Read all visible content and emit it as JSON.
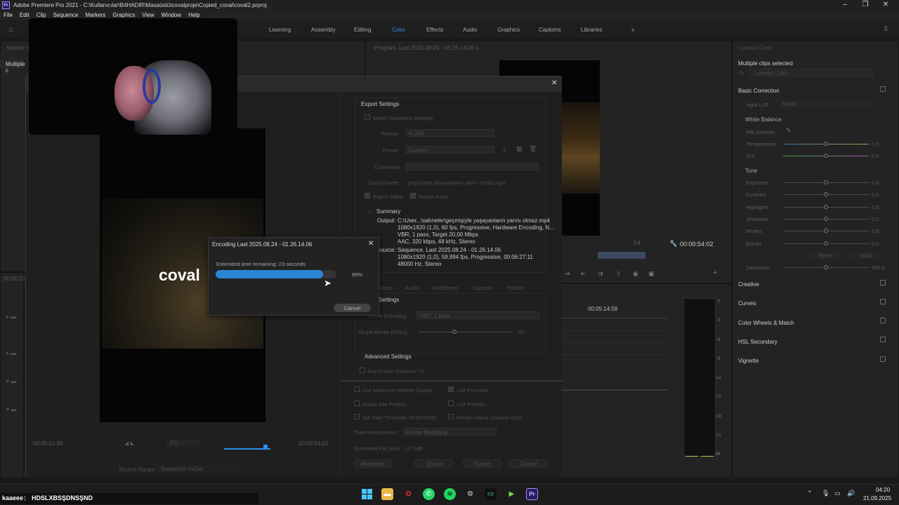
{
  "window": {
    "app_icon": "Pr",
    "title": "Adobe Premiere Pro 2021 - C:\\Kullanıcılar\\B4HADIR\\Masaüstü\\covalproje\\Copied_coval\\coval2.prproj",
    "controls": [
      "–",
      "❐",
      "✕"
    ]
  },
  "menu": [
    "File",
    "Edit",
    "Clip",
    "Sequence",
    "Markers",
    "Graphics",
    "View",
    "Window",
    "Help"
  ],
  "workspaces": {
    "tabs": [
      "Learning",
      "Assembly",
      "Editing",
      "Color",
      "Effects",
      "Audio",
      "Graphics",
      "Captions",
      "Libraries"
    ],
    "active": "Color",
    "more": "»"
  },
  "source_monitor": {
    "label": "Source: (no clips)",
    "timecode_left": "00:05:01:38"
  },
  "program_monitor": {
    "label": "Program: Last 2025.08.24 - 01.26.14.06  ≡",
    "timecode": "00:00:54:02",
    "zoom": "1/4"
  },
  "left_panel": {
    "header": "Multiple c",
    "timecode": "00:05:01:"
  },
  "timeline": {
    "timecode": "00:05:14:58"
  },
  "lumetri": {
    "title": "Lumetri Color",
    "clip_info": "Multiple clips selected",
    "fx_selector": "Lumetri Color",
    "basic_correction": "Basic Correction",
    "input_lut_label": "Input LUT",
    "input_lut_value": "None",
    "white_balance": "White Balance",
    "wb_selector": "WB Selector",
    "temperature": {
      "label": "Temperature",
      "value": "0,0"
    },
    "tint": {
      "label": "Tint",
      "value": "0,0"
    },
    "tone": "Tone",
    "exposure": {
      "label": "Exposure",
      "value": "0,0"
    },
    "contrast": {
      "label": "Contrast",
      "value": "0,0"
    },
    "highlights": {
      "label": "Highlights",
      "value": "0,0"
    },
    "shadows": {
      "label": "Shadows",
      "value": "0,0"
    },
    "whites": {
      "label": "Whites",
      "value": "0,0"
    },
    "blacks": {
      "label": "Blacks",
      "value": "0,0"
    },
    "reset": "Reset",
    "auto": "Auto",
    "saturation": {
      "label": "Saturation",
      "value": "100,0"
    },
    "sections": [
      "Creative",
      "Curves",
      "Color Wheels & Match",
      "HSL Secondary",
      "Vignette"
    ]
  },
  "export_dialog": {
    "close": "✕",
    "preview_text": "coval",
    "source_range_label": "Source Range:",
    "source_range_value": "Sequence In/Out",
    "fit": "Fit",
    "timecode_left": "00:05:01:38",
    "timecode_right": "00:00:54:02",
    "export_settings": "Export Settings",
    "match_sequence": "Match Sequence Settings",
    "format_label": "Format:",
    "format_value": "H.264",
    "preset_label": "Preset:",
    "preset_value": "Custom",
    "comments_label": "Comments:",
    "output_name_label": "Output Name:",
    "output_name_value": "geçmişiyle yaşayanların yarını olmaz.mp4",
    "export_video": "Export Video",
    "export_audio": "Export Audio",
    "summary": "Summary",
    "output_label": "Output:",
    "output_lines": [
      "C:\\User...\\sahneler\\geçmişiyle yaşayanların yarını olmaz.mp4",
      "1080x1920 (1,0), 60 fps, Progressive, Hardware Encoding, N...",
      "VBR, 1 pass, Target 20,00 Mbps",
      "AAC, 320 kbps, 48 kHz, Stereo"
    ],
    "source_label": "Source:",
    "source_lines": [
      "Sequence, Last 2025.08.24 - 01.26.14.06",
      "1080x1920 (1,0), 59,994 fps, Progressive, 00:06:27:11",
      "48000 Hz, Stereo"
    ],
    "tabs": [
      "Video",
      "Audio",
      "Multiplexer",
      "Captions",
      "Publish"
    ],
    "bitrate_settings": "Bitrate Settings",
    "bitrate_encoding_label": "Bitrate Encoding:",
    "bitrate_encoding_value": "VBR, 1 pass",
    "target_bitrate_label": "Target Bitrate [Mbps]:",
    "target_bitrate_value": "20",
    "advanced_settings": "Advanced Settings",
    "key_frame_label": "Key Frame Distance:",
    "key_frame_value": "72",
    "use_max_render": "Use Maximum Render Quality",
    "use_previews": "Use Previews",
    "import_into_project": "Import into Project",
    "use_proxies": "Use Proxies",
    "set_start_timecode": "Set Start Timecode",
    "start_timecode": "00:00:00:00",
    "render_alpha": "Render Alpha Channel Only",
    "time_interp_label": "Time Interpolation:",
    "time_interp_value": "Frame Sampling",
    "file_size_label": "Estimated File Size:",
    "file_size_value": "137 MB",
    "buttons": [
      "Metadata...",
      "Queue",
      "Export",
      "Cancel"
    ]
  },
  "encoding": {
    "title": "Encoding Last 2025.08.24 - 01.26.14.06",
    "close": "✕",
    "estimate": "Estimated time remaining: 23 seconds",
    "progress": 0.89,
    "percent": "89%",
    "cancel": "Cancel"
  },
  "meter_scale": [
    "0",
    "-3",
    "-6",
    "-9",
    "-12",
    "-15",
    "-18",
    "-21",
    "dB"
  ],
  "chat": {
    "user": "kaaeee",
    "sep": " : ",
    "message": "HDSLXBSŞDNSŞND"
  },
  "taskbar": {
    "time": "04:20",
    "date": "21.09.2025"
  }
}
